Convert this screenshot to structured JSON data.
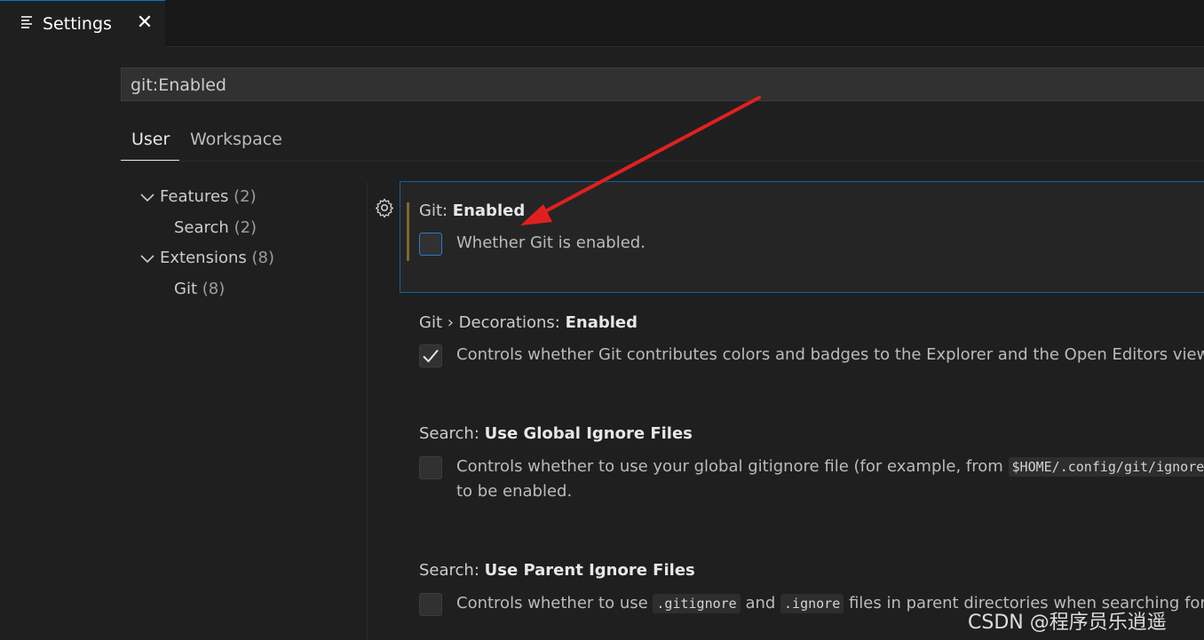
{
  "editor_tab": {
    "title": "Settings",
    "close_glyph": "✕"
  },
  "search": {
    "value": "git:Enabled"
  },
  "scope_tabs": {
    "user": "User",
    "workspace": "Workspace"
  },
  "toc": [
    {
      "label": "Features",
      "count": "(2)"
    },
    {
      "label": "Search",
      "count": "(2)"
    },
    {
      "label": "Extensions",
      "count": "(8)"
    },
    {
      "label": "Git",
      "count": "(8)"
    }
  ],
  "settings": [
    {
      "category": "Git: ",
      "name": "Enabled",
      "checked": false,
      "description": "Whether Git is enabled."
    },
    {
      "category": "Git › Decorations: ",
      "name": "Enabled",
      "checked": true,
      "description": "Controls whether Git contributes colors and badges to the Explorer and the Open Editors view."
    },
    {
      "category": "Search: ",
      "name": "Use Global Ignore Files",
      "checked": false,
      "description_pre": "Controls whether to use your global gitignore file (for example, from ",
      "description_code": "$HOME/.config/git/ignore",
      "description_line2": "to be enabled."
    },
    {
      "category": "Search: ",
      "name": "Use Parent Ignore Files",
      "checked": false,
      "description_pre": "Controls whether to use ",
      "code1": ".gitignore",
      "mid": " and ",
      "code2": ".ignore",
      "description_post": " files in parent directories when searching for"
    }
  ],
  "colors": {
    "accent": "#0078d4",
    "annotation_arrow": "#e02020"
  },
  "icons": {
    "tab": "settings-list-icon",
    "gear": "gear-icon",
    "check": "check-icon",
    "chevron": "chevron-down-icon"
  },
  "watermark": "CSDN @程序员乐逍遥"
}
